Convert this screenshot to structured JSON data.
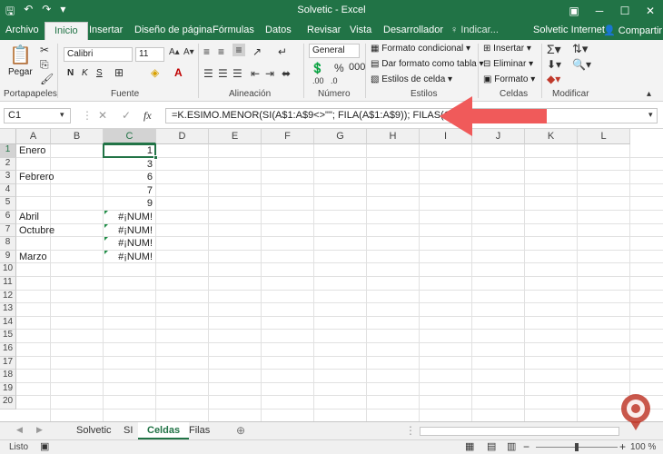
{
  "window": {
    "title": "Solvetic - Excel"
  },
  "tabs": [
    "Archivo",
    "Inicio",
    "Insertar",
    "Diseño de página",
    "Fórmulas",
    "Datos",
    "Revisar",
    "Vista",
    "Desarrollador"
  ],
  "tell_me": "Indicar...",
  "account": "Solvetic Internet",
  "share": "Compartir",
  "ribbon": {
    "clipboard": {
      "paste": "Pegar",
      "label": "Portapapeles"
    },
    "font": {
      "name": "Calibri",
      "size": "11",
      "bold": "N",
      "italic": "K",
      "underline": "S",
      "label": "Fuente"
    },
    "alignment": {
      "label": "Alineación"
    },
    "number": {
      "format": "General",
      "label": "Número"
    },
    "styles": {
      "conditional": "Formato condicional",
      "table": "Dar formato como tabla",
      "cell": "Estilos de celda",
      "label": "Estilos"
    },
    "cells": {
      "insert": "Insertar",
      "delete": "Eliminar",
      "format": "Formato",
      "label": "Celdas"
    },
    "editing": {
      "label": "Modificar"
    }
  },
  "formula_bar": {
    "name_box": "C1",
    "fx": "fx",
    "formula": "=K.ESIMO.MENOR(SI(A$1:A$9<>\"\"; FILA(A$1:A$9)); FILAS(C$1:C1))"
  },
  "columns": [
    "A",
    "B",
    "C",
    "D",
    "E",
    "F",
    "G",
    "H",
    "I",
    "J",
    "K",
    "L"
  ],
  "rows": [
    "1",
    "2",
    "3",
    "4",
    "5",
    "6",
    "7",
    "8",
    "9",
    "10",
    "11",
    "12",
    "13",
    "14",
    "15",
    "16",
    "17",
    "18",
    "19",
    "20"
  ],
  "cells_a": [
    {
      "row": 1,
      "value": "Enero"
    },
    {
      "row": 3,
      "value": "Febrero"
    },
    {
      "row": 6,
      "value": "Abril"
    },
    {
      "row": 7,
      "value": "Octubre"
    },
    {
      "row": 9,
      "value": "Marzo"
    }
  ],
  "cells_c": [
    {
      "row": 1,
      "value": "1",
      "error": false
    },
    {
      "row": 2,
      "value": "3",
      "error": false
    },
    {
      "row": 3,
      "value": "6",
      "error": false
    },
    {
      "row": 4,
      "value": "7",
      "error": false
    },
    {
      "row": 5,
      "value": "9",
      "error": false
    },
    {
      "row": 6,
      "value": "#¡NUM!",
      "error": true
    },
    {
      "row": 7,
      "value": "#¡NUM!",
      "error": true
    },
    {
      "row": 8,
      "value": "#¡NUM!",
      "error": true
    },
    {
      "row": 9,
      "value": "#¡NUM!",
      "error": true
    }
  ],
  "sheets": [
    "Solvetic",
    "SI",
    "Celdas",
    "Filas"
  ],
  "active_sheet": "Celdas",
  "status": {
    "ready": "Listo",
    "zoom": "100 %"
  },
  "colors": {
    "brand": "#217346",
    "arrow": "#f05a5a",
    "error_marker": "#1e8c45"
  }
}
